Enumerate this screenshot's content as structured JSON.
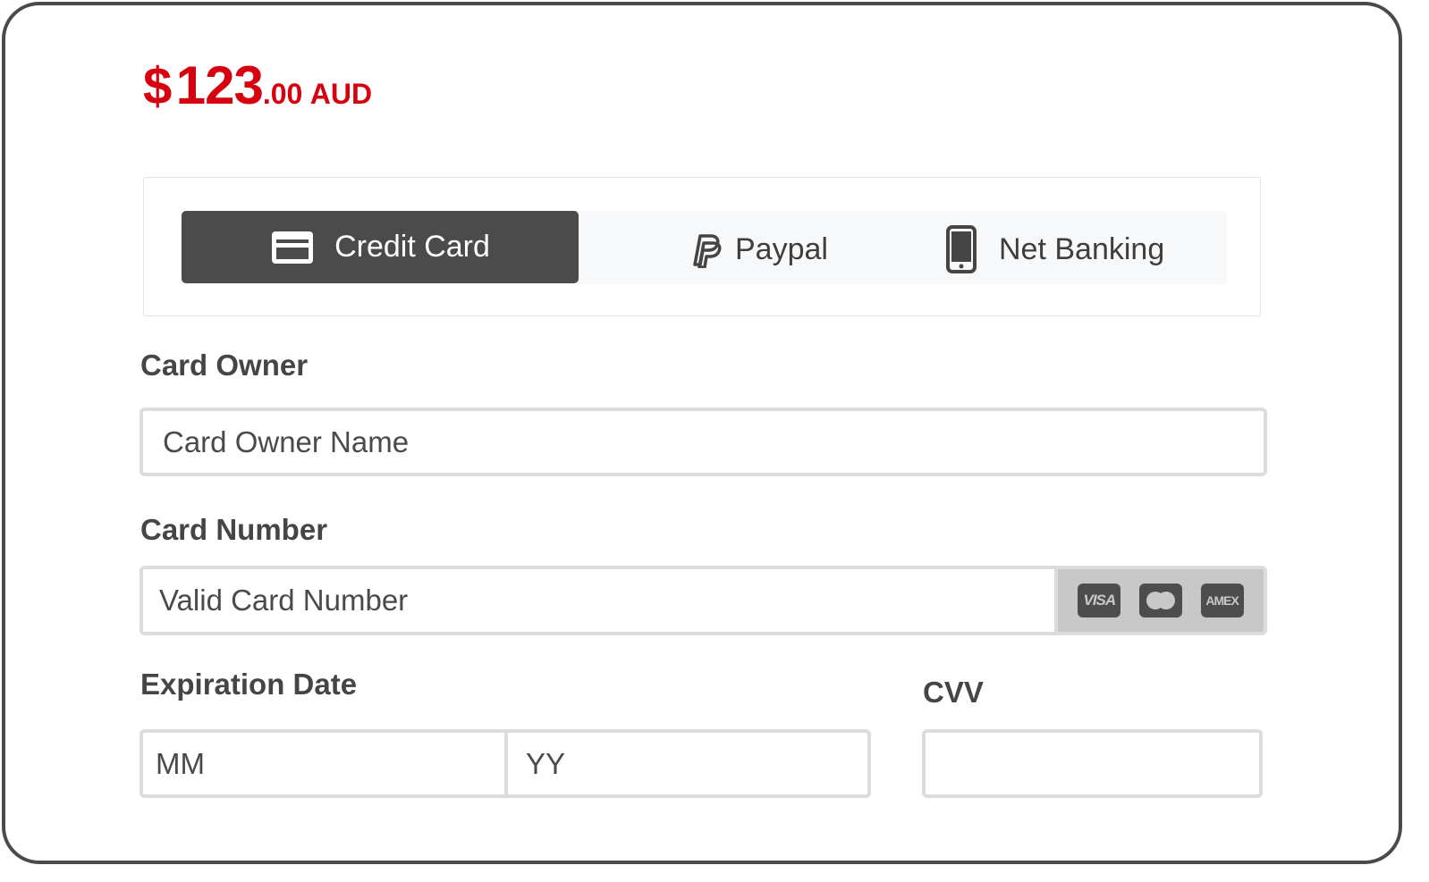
{
  "price": {
    "currency_symbol": "$",
    "amount_integer": "123",
    "amount_decimal": ".00",
    "currency_code": "AUD",
    "color": "#d6000f"
  },
  "payment_tabs": {
    "items": [
      {
        "label": "Credit Card",
        "icon": "credit-card-icon",
        "active": true
      },
      {
        "label": "Paypal",
        "icon": "paypal-icon",
        "active": false
      },
      {
        "label": "Net Banking",
        "icon": "mobile-phone-icon",
        "active": false
      }
    ],
    "active_color": "#4b4b4b"
  },
  "form": {
    "card_owner": {
      "label": "Card Owner",
      "placeholder": "Card Owner Name",
      "value": ""
    },
    "card_number": {
      "label": "Card Number",
      "placeholder": "Valid Card Number",
      "value": "",
      "brands": [
        {
          "name": "visa-icon",
          "text": "VISA"
        },
        {
          "name": "mastercard-icon",
          "text": ""
        },
        {
          "name": "amex-icon",
          "text": "AMEX"
        }
      ]
    },
    "expiration": {
      "label": "Expiration Date",
      "month_placeholder": "MM",
      "year_placeholder": "YY"
    },
    "cvv": {
      "label": "CVV",
      "placeholder": "",
      "value": ""
    }
  }
}
